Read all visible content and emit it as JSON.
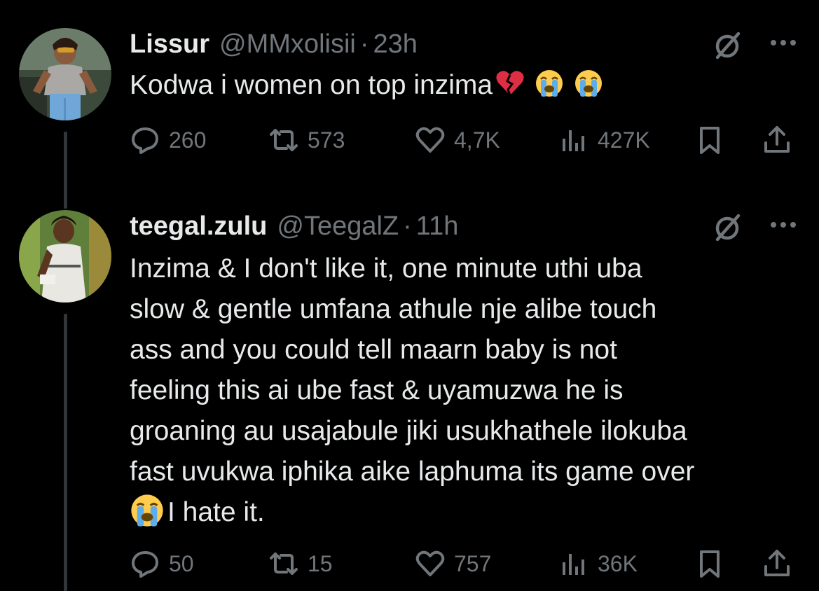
{
  "tweets": [
    {
      "name": "Lissur",
      "handle": "@MMxolisii",
      "separator": "·",
      "time": "23h",
      "text_lines": [
        "Kodwa i women on top inzima"
      ],
      "emojis": [
        "broken-heart-icon",
        "loudly-crying-face-icon",
        "loudly-crying-face-icon"
      ],
      "replies": "260",
      "reposts": "573",
      "likes": "4,7K",
      "views": "427K"
    },
    {
      "name": "teegal.zulu",
      "handle": "@TeegalZ",
      "separator": "·",
      "time": "11h",
      "text_lines": [
        "Inzima & I don't like it, one minute uthi uba",
        "slow & gentle umfana athule nje alibe touch",
        "ass and you could tell maarn baby is not",
        "feeling this ai ube fast & uyamuzwa he is",
        "groaning au usajabule jiki usukhathele ilokuba",
        "fast uvukwa iphika aike laphuma its game over"
      ],
      "last_line_text": "I hate it.",
      "emojis": [
        "loudly-crying-face-icon"
      ],
      "replies": "50",
      "reposts": "15",
      "likes": "757",
      "views": "36K"
    }
  ],
  "colors": {
    "background": "#000000",
    "primary_text": "#e7e9ea",
    "secondary_text": "#71767b",
    "thread_line": "#333639",
    "heart_red": "#dd2e44",
    "emoji_yellow": "#ffcc4d",
    "tear_blue": "#5dadec"
  }
}
